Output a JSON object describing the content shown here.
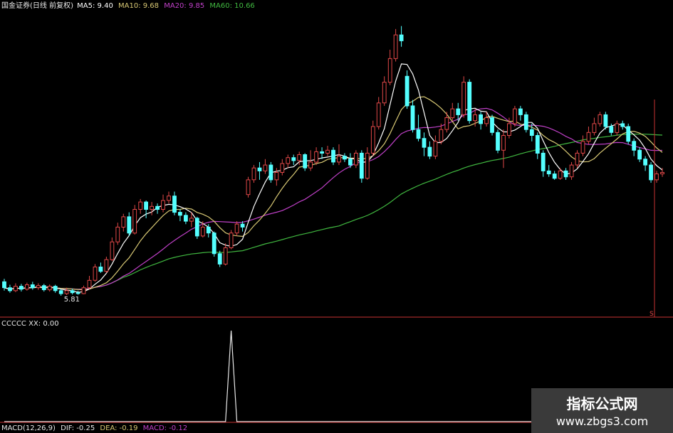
{
  "header": {
    "title": "国金证券(日线 前复权)",
    "ma5_label": "MA5: 9.40",
    "ma10_label": "MA10: 9.68",
    "ma20_label": "MA20: 9.85",
    "ma60_label": "MA60: 10.66"
  },
  "sub_header": {
    "indicator_label": "CCCCC XX: 0.00"
  },
  "macd_header": {
    "name": "MACD(12,26,9)",
    "dif": "DIF: -0.25",
    "dea": "DEA: -0.19",
    "macd": "MACD: -0.12"
  },
  "watermark": {
    "line1": "指标公式网",
    "line2": "www.zbgs3.com"
  },
  "colors": {
    "up": "#e04848",
    "down": "#54ffff",
    "ma5": "#ffffff",
    "ma10": "#d8c874",
    "ma20": "#c040c8",
    "ma60": "#40b840",
    "axis": "#c83232",
    "indicator": "#e8e8e8"
  },
  "chart_data": {
    "type": "candlestick",
    "ylim": [
      5.2,
      15.3
    ],
    "low_annotation": "5.81",
    "axis_marker": "S",
    "candles": [
      {
        "o": 6.25,
        "c": 6.05,
        "h": 6.35,
        "l": 5.95
      },
      {
        "o": 6.05,
        "c": 5.95,
        "h": 6.15,
        "l": 5.88
      },
      {
        "o": 5.95,
        "c": 6.1,
        "h": 6.2,
        "l": 5.9
      },
      {
        "o": 6.1,
        "c": 6.0,
        "h": 6.18,
        "l": 5.92
      },
      {
        "o": 6.0,
        "c": 6.15,
        "h": 6.22,
        "l": 5.95
      },
      {
        "o": 6.15,
        "c": 6.05,
        "h": 6.25,
        "l": 5.98
      },
      {
        "o": 6.05,
        "c": 6.12,
        "h": 6.2,
        "l": 5.98
      },
      {
        "o": 6.12,
        "c": 5.98,
        "h": 6.18,
        "l": 5.92
      },
      {
        "o": 5.98,
        "c": 6.1,
        "h": 6.16,
        "l": 5.92
      },
      {
        "o": 6.1,
        "c": 5.95,
        "h": 6.15,
        "l": 5.88
      },
      {
        "o": 5.95,
        "c": 5.85,
        "h": 6.0,
        "l": 5.78
      },
      {
        "o": 5.85,
        "c": 5.95,
        "h": 6.05,
        "l": 5.8
      },
      {
        "o": 5.95,
        "c": 5.88,
        "h": 6.02,
        "l": 5.82
      },
      {
        "o": 5.88,
        "c": 5.85,
        "h": 5.95,
        "l": 5.81
      },
      {
        "o": 5.85,
        "c": 6.05,
        "h": 6.12,
        "l": 5.83
      },
      {
        "o": 6.05,
        "c": 6.3,
        "h": 6.45,
        "l": 6.0
      },
      {
        "o": 6.3,
        "c": 6.75,
        "h": 6.85,
        "l": 6.25
      },
      {
        "o": 6.75,
        "c": 6.6,
        "h": 6.9,
        "l": 6.55
      },
      {
        "o": 6.6,
        "c": 7.0,
        "h": 7.1,
        "l": 6.55
      },
      {
        "o": 7.0,
        "c": 7.6,
        "h": 7.75,
        "l": 6.95
      },
      {
        "o": 7.6,
        "c": 8.1,
        "h": 8.25,
        "l": 7.5
      },
      {
        "o": 8.1,
        "c": 8.45,
        "h": 8.55,
        "l": 7.95
      },
      {
        "o": 8.45,
        "c": 7.9,
        "h": 8.6,
        "l": 7.8
      },
      {
        "o": 7.9,
        "c": 8.7,
        "h": 8.85,
        "l": 7.85
      },
      {
        "o": 8.7,
        "c": 8.95,
        "h": 9.05,
        "l": 8.55
      },
      {
        "o": 8.95,
        "c": 8.7,
        "h": 9.0,
        "l": 8.4
      },
      {
        "o": 8.7,
        "c": 8.8,
        "h": 8.95,
        "l": 8.5
      },
      {
        "o": 8.8,
        "c": 8.7,
        "h": 8.9,
        "l": 8.55
      },
      {
        "o": 8.7,
        "c": 9.0,
        "h": 9.2,
        "l": 8.6
      },
      {
        "o": 9.0,
        "c": 9.15,
        "h": 9.3,
        "l": 8.9
      },
      {
        "o": 9.15,
        "c": 8.6,
        "h": 9.3,
        "l": 8.5
      },
      {
        "o": 8.6,
        "c": 8.5,
        "h": 8.7,
        "l": 8.3
      },
      {
        "o": 8.5,
        "c": 8.3,
        "h": 8.6,
        "l": 8.2
      },
      {
        "o": 8.3,
        "c": 8.4,
        "h": 8.6,
        "l": 8.1
      },
      {
        "o": 8.4,
        "c": 7.8,
        "h": 8.45,
        "l": 7.7
      },
      {
        "o": 7.8,
        "c": 8.1,
        "h": 8.3,
        "l": 7.75
      },
      {
        "o": 8.1,
        "c": 7.9,
        "h": 8.2,
        "l": 7.75
      },
      {
        "o": 7.9,
        "c": 7.2,
        "h": 7.95,
        "l": 7.1
      },
      {
        "o": 7.2,
        "c": 6.85,
        "h": 7.3,
        "l": 6.75
      },
      {
        "o": 6.85,
        "c": 7.4,
        "h": 7.55,
        "l": 6.8
      },
      {
        "o": 7.4,
        "c": 7.9,
        "h": 8.0,
        "l": 7.35
      },
      {
        "o": 7.9,
        "c": 8.2,
        "h": 8.3,
        "l": 7.8
      },
      {
        "o": 8.2,
        "c": 8.1,
        "h": 8.3,
        "l": 7.95
      },
      {
        "o": 9.2,
        "c": 9.7,
        "h": 9.8,
        "l": 9.1
      },
      {
        "o": 9.7,
        "c": 10.1,
        "h": 10.2,
        "l": 9.6
      },
      {
        "o": 10.1,
        "c": 10.0,
        "h": 10.3,
        "l": 9.7
      },
      {
        "o": 10.0,
        "c": 10.2,
        "h": 10.4,
        "l": 9.9
      },
      {
        "o": 10.2,
        "c": 9.7,
        "h": 10.3,
        "l": 9.6
      },
      {
        "o": 9.7,
        "c": 9.95,
        "h": 10.1,
        "l": 9.5
      },
      {
        "o": 9.95,
        "c": 10.25,
        "h": 10.4,
        "l": 9.85
      },
      {
        "o": 10.25,
        "c": 10.45,
        "h": 10.55,
        "l": 10.1
      },
      {
        "o": 10.45,
        "c": 10.35,
        "h": 10.55,
        "l": 10.2
      },
      {
        "o": 10.35,
        "c": 10.55,
        "h": 10.65,
        "l": 10.2
      },
      {
        "o": 10.55,
        "c": 10.1,
        "h": 10.6,
        "l": 10.0
      },
      {
        "o": 10.1,
        "c": 10.3,
        "h": 10.7,
        "l": 10.0
      },
      {
        "o": 10.3,
        "c": 10.65,
        "h": 10.8,
        "l": 10.2
      },
      {
        "o": 10.65,
        "c": 10.6,
        "h": 10.8,
        "l": 10.4
      },
      {
        "o": 10.6,
        "c": 10.7,
        "h": 10.85,
        "l": 10.5
      },
      {
        "o": 10.7,
        "c": 10.3,
        "h": 10.8,
        "l": 10.2
      },
      {
        "o": 10.3,
        "c": 10.5,
        "h": 10.9,
        "l": 10.2
      },
      {
        "o": 10.5,
        "c": 10.4,
        "h": 10.6,
        "l": 10.3
      },
      {
        "o": 10.4,
        "c": 10.2,
        "h": 10.6,
        "l": 10.1
      },
      {
        "o": 10.2,
        "c": 10.6,
        "h": 10.7,
        "l": 10.1
      },
      {
        "o": 10.6,
        "c": 9.75,
        "h": 10.7,
        "l": 9.6
      },
      {
        "o": 9.75,
        "c": 10.6,
        "h": 10.8,
        "l": 9.7
      },
      {
        "o": 10.6,
        "c": 11.5,
        "h": 11.7,
        "l": 10.5
      },
      {
        "o": 11.5,
        "c": 12.3,
        "h": 12.5,
        "l": 11.4
      },
      {
        "o": 12.3,
        "c": 13.0,
        "h": 13.2,
        "l": 12.2
      },
      {
        "o": 13.0,
        "c": 13.8,
        "h": 14.1,
        "l": 12.9
      },
      {
        "o": 13.8,
        "c": 14.6,
        "h": 14.8,
        "l": 13.7
      },
      {
        "o": 14.6,
        "c": 14.4,
        "h": 14.9,
        "l": 14.2
      },
      {
        "o": 13.2,
        "c": 12.2,
        "h": 13.4,
        "l": 12.1
      },
      {
        "o": 12.2,
        "c": 11.4,
        "h": 12.4,
        "l": 11.3
      },
      {
        "o": 11.4,
        "c": 11.1,
        "h": 11.9,
        "l": 11.0
      },
      {
        "o": 11.1,
        "c": 10.8,
        "h": 11.3,
        "l": 10.5
      },
      {
        "o": 10.8,
        "c": 10.5,
        "h": 11.0,
        "l": 10.4
      },
      {
        "o": 10.5,
        "c": 11.0,
        "h": 11.2,
        "l": 10.4
      },
      {
        "o": 11.0,
        "c": 11.4,
        "h": 11.6,
        "l": 10.9
      },
      {
        "o": 11.4,
        "c": 11.8,
        "h": 12.0,
        "l": 11.3
      },
      {
        "o": 11.8,
        "c": 12.1,
        "h": 12.3,
        "l": 11.7
      },
      {
        "o": 12.1,
        "c": 11.9,
        "h": 12.3,
        "l": 11.7
      },
      {
        "o": 11.9,
        "c": 13.0,
        "h": 13.2,
        "l": 11.8
      },
      {
        "o": 13.0,
        "c": 11.7,
        "h": 13.1,
        "l": 11.6
      },
      {
        "o": 11.7,
        "c": 11.9,
        "h": 12.1,
        "l": 11.5
      },
      {
        "o": 11.9,
        "c": 11.6,
        "h": 12.0,
        "l": 11.4
      },
      {
        "o": 11.6,
        "c": 11.8,
        "h": 12.0,
        "l": 11.5
      },
      {
        "o": 11.8,
        "c": 11.3,
        "h": 11.9,
        "l": 11.2
      },
      {
        "o": 11.3,
        "c": 10.7,
        "h": 11.4,
        "l": 10.6
      },
      {
        "o": 10.7,
        "c": 11.2,
        "h": 11.4,
        "l": 10.1
      },
      {
        "o": 11.2,
        "c": 11.6,
        "h": 11.8,
        "l": 11.1
      },
      {
        "o": 11.6,
        "c": 12.1,
        "h": 12.2,
        "l": 11.5
      },
      {
        "o": 12.1,
        "c": 11.9,
        "h": 12.2,
        "l": 11.7
      },
      {
        "o": 11.9,
        "c": 11.4,
        "h": 12.0,
        "l": 11.3
      },
      {
        "o": 11.4,
        "c": 11.2,
        "h": 11.6,
        "l": 11.0
      },
      {
        "o": 11.2,
        "c": 10.6,
        "h": 11.3,
        "l": 10.4
      },
      {
        "o": 10.6,
        "c": 10.0,
        "h": 10.7,
        "l": 9.8
      },
      {
        "o": 10.0,
        "c": 9.9,
        "h": 10.2,
        "l": 9.8
      },
      {
        "o": 9.9,
        "c": 9.75,
        "h": 10.0,
        "l": 9.7
      },
      {
        "o": 9.75,
        "c": 10.0,
        "h": 10.1,
        "l": 9.7
      },
      {
        "o": 10.0,
        "c": 9.8,
        "h": 10.1,
        "l": 9.7
      },
      {
        "o": 9.8,
        "c": 10.2,
        "h": 10.3,
        "l": 9.7
      },
      {
        "o": 10.2,
        "c": 10.6,
        "h": 10.7,
        "l": 10.1
      },
      {
        "o": 10.6,
        "c": 11.0,
        "h": 11.2,
        "l": 10.5
      },
      {
        "o": 11.0,
        "c": 11.3,
        "h": 11.5,
        "l": 10.9
      },
      {
        "o": 11.3,
        "c": 11.6,
        "h": 11.8,
        "l": 11.2
      },
      {
        "o": 11.6,
        "c": 11.9,
        "h": 12.0,
        "l": 11.5
      },
      {
        "o": 11.9,
        "c": 11.5,
        "h": 12.0,
        "l": 11.4
      },
      {
        "o": 11.5,
        "c": 11.3,
        "h": 11.6,
        "l": 11.2
      },
      {
        "o": 11.3,
        "c": 11.6,
        "h": 11.7,
        "l": 11.2
      },
      {
        "o": 11.6,
        "c": 11.5,
        "h": 11.7,
        "l": 11.4
      },
      {
        "o": 11.5,
        "c": 11.0,
        "h": 11.6,
        "l": 10.9
      },
      {
        "o": 11.0,
        "c": 10.7,
        "h": 11.1,
        "l": 10.5
      },
      {
        "o": 10.7,
        "c": 10.4,
        "h": 10.8,
        "l": 10.3
      },
      {
        "o": 10.4,
        "c": 10.2,
        "h": 10.5,
        "l": 10.0
      },
      {
        "o": 10.2,
        "c": 9.7,
        "h": 10.3,
        "l": 9.6
      },
      {
        "o": 9.7,
        "c": 9.9,
        "h": 10.0,
        "l": 9.6
      },
      {
        "o": 9.9,
        "c": 9.95,
        "h": 10.1,
        "l": 9.8
      }
    ],
    "indicator": {
      "values": [
        0,
        0,
        0,
        0,
        0,
        0,
        0,
        0,
        0,
        0,
        0,
        0,
        0,
        0,
        0,
        0,
        0,
        0,
        0,
        0,
        0,
        0,
        0,
        0,
        0,
        0,
        0,
        0,
        0,
        0,
        0,
        0,
        0,
        0,
        0,
        0,
        0,
        0,
        0,
        0,
        0,
        0,
        0,
        0,
        0,
        0,
        0,
        0,
        0,
        0,
        0,
        0,
        0,
        0,
        0,
        0,
        0,
        0,
        0,
        0,
        0,
        0,
        0,
        0,
        0,
        0,
        0,
        0,
        0,
        0,
        0,
        0,
        0,
        0,
        0,
        0,
        0,
        0,
        0,
        0,
        0,
        0,
        0,
        0,
        0,
        0,
        0,
        0,
        0,
        0,
        0,
        0,
        0,
        0,
        0,
        0,
        0,
        0,
        0,
        0,
        0,
        0,
        0,
        0,
        0,
        0,
        0,
        0,
        0,
        0,
        0,
        0,
        0,
        0,
        0,
        0,
        0,
        0,
        0,
        0,
        0,
        0,
        0,
        0,
        0,
        0,
        0,
        0
      ],
      "spike_index": 40,
      "spike_value": 1
    }
  }
}
